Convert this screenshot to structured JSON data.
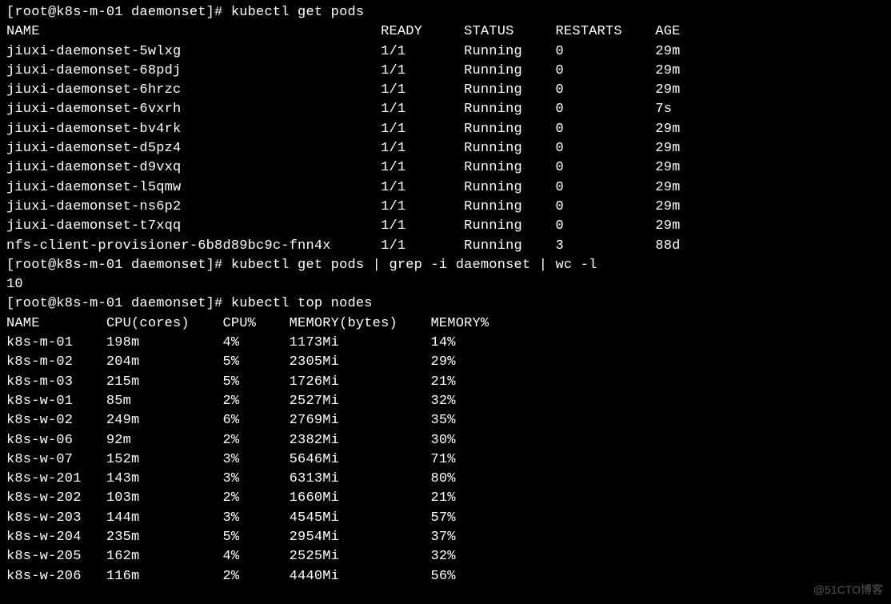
{
  "prompt_user": "root",
  "prompt_host": "k8s-m-01",
  "prompt_dir": "daemonset",
  "cmd1": "kubectl get pods",
  "pods_header": {
    "name": "NAME",
    "ready": "READY",
    "status": "STATUS",
    "restarts": "RESTARTS",
    "age": "AGE"
  },
  "pods": [
    {
      "name": "jiuxi-daemonset-5wlxg",
      "ready": "1/1",
      "status": "Running",
      "restarts": "0",
      "age": "29m"
    },
    {
      "name": "jiuxi-daemonset-68pdj",
      "ready": "1/1",
      "status": "Running",
      "restarts": "0",
      "age": "29m"
    },
    {
      "name": "jiuxi-daemonset-6hrzc",
      "ready": "1/1",
      "status": "Running",
      "restarts": "0",
      "age": "29m"
    },
    {
      "name": "jiuxi-daemonset-6vxrh",
      "ready": "1/1",
      "status": "Running",
      "restarts": "0",
      "age": "7s"
    },
    {
      "name": "jiuxi-daemonset-bv4rk",
      "ready": "1/1",
      "status": "Running",
      "restarts": "0",
      "age": "29m"
    },
    {
      "name": "jiuxi-daemonset-d5pz4",
      "ready": "1/1",
      "status": "Running",
      "restarts": "0",
      "age": "29m"
    },
    {
      "name": "jiuxi-daemonset-d9vxq",
      "ready": "1/1",
      "status": "Running",
      "restarts": "0",
      "age": "29m"
    },
    {
      "name": "jiuxi-daemonset-l5qmw",
      "ready": "1/1",
      "status": "Running",
      "restarts": "0",
      "age": "29m"
    },
    {
      "name": "jiuxi-daemonset-ns6p2",
      "ready": "1/1",
      "status": "Running",
      "restarts": "0",
      "age": "29m"
    },
    {
      "name": "jiuxi-daemonset-t7xqq",
      "ready": "1/1",
      "status": "Running",
      "restarts": "0",
      "age": "29m"
    },
    {
      "name": "nfs-client-provisioner-6b8d89bc9c-fnn4x",
      "ready": "1/1",
      "status": "Running",
      "restarts": "3",
      "age": "88d"
    }
  ],
  "cmd2": "kubectl get pods | grep -i daemonset | wc -l",
  "cmd2_output": "10",
  "cmd3": "kubectl top nodes",
  "nodes_header": {
    "name": "NAME",
    "cpu_cores": "CPU(cores)",
    "cpu_pct": "CPU%",
    "mem_bytes": "MEMORY(bytes)",
    "mem_pct": "MEMORY%"
  },
  "nodes": [
    {
      "name": "k8s-m-01",
      "cpu_cores": "198m",
      "cpu_pct": "4%",
      "mem_bytes": "1173Mi",
      "mem_pct": "14%"
    },
    {
      "name": "k8s-m-02",
      "cpu_cores": "204m",
      "cpu_pct": "5%",
      "mem_bytes": "2305Mi",
      "mem_pct": "29%"
    },
    {
      "name": "k8s-m-03",
      "cpu_cores": "215m",
      "cpu_pct": "5%",
      "mem_bytes": "1726Mi",
      "mem_pct": "21%"
    },
    {
      "name": "k8s-w-01",
      "cpu_cores": "85m",
      "cpu_pct": "2%",
      "mem_bytes": "2527Mi",
      "mem_pct": "32%"
    },
    {
      "name": "k8s-w-02",
      "cpu_cores": "249m",
      "cpu_pct": "6%",
      "mem_bytes": "2769Mi",
      "mem_pct": "35%"
    },
    {
      "name": "k8s-w-06",
      "cpu_cores": "92m",
      "cpu_pct": "2%",
      "mem_bytes": "2382Mi",
      "mem_pct": "30%"
    },
    {
      "name": "k8s-w-07",
      "cpu_cores": "152m",
      "cpu_pct": "3%",
      "mem_bytes": "5646Mi",
      "mem_pct": "71%"
    },
    {
      "name": "k8s-w-201",
      "cpu_cores": "143m",
      "cpu_pct": "3%",
      "mem_bytes": "6313Mi",
      "mem_pct": "80%"
    },
    {
      "name": "k8s-w-202",
      "cpu_cores": "103m",
      "cpu_pct": "2%",
      "mem_bytes": "1660Mi",
      "mem_pct": "21%"
    },
    {
      "name": "k8s-w-203",
      "cpu_cores": "144m",
      "cpu_pct": "3%",
      "mem_bytes": "4545Mi",
      "mem_pct": "57%"
    },
    {
      "name": "k8s-w-204",
      "cpu_cores": "235m",
      "cpu_pct": "5%",
      "mem_bytes": "2954Mi",
      "mem_pct": "37%"
    },
    {
      "name": "k8s-w-205",
      "cpu_cores": "162m",
      "cpu_pct": "4%",
      "mem_bytes": "2525Mi",
      "mem_pct": "32%"
    },
    {
      "name": "k8s-w-206",
      "cpu_cores": "116m",
      "cpu_pct": "2%",
      "mem_bytes": "4440Mi",
      "mem_pct": "56%"
    }
  ],
  "watermark": "@51CTO博客"
}
